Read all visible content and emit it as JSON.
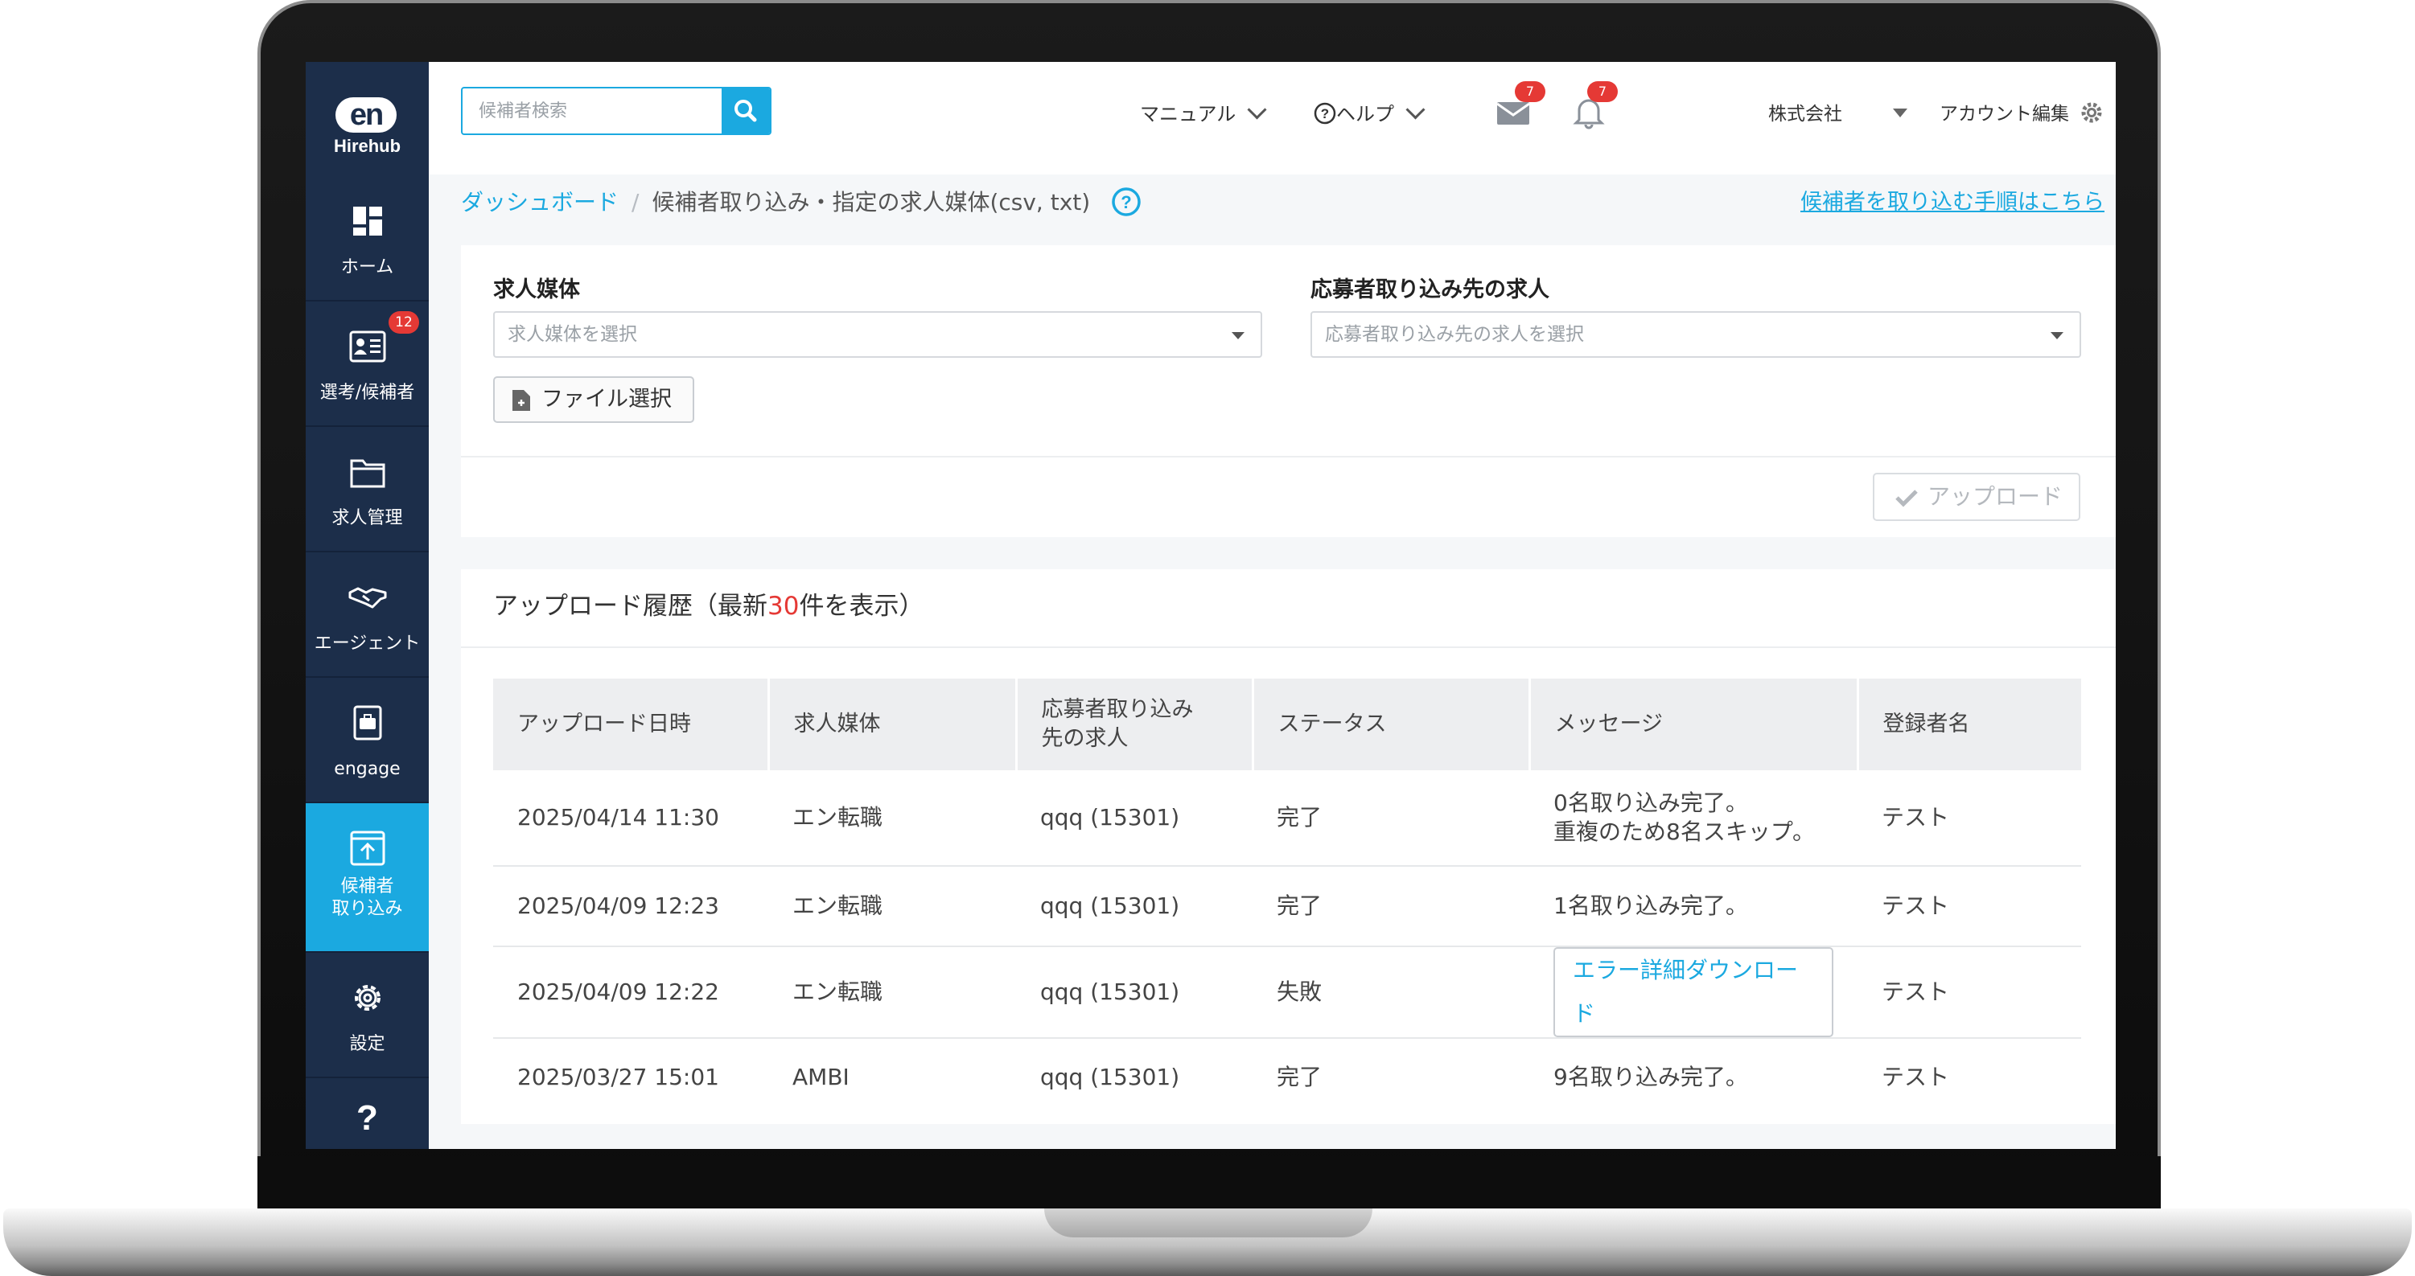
{
  "app": {
    "logo_mark": "en",
    "logo_brand": "Hirehub"
  },
  "sidebar": {
    "items": [
      {
        "label": "ホーム",
        "icon": "dashboard-icon"
      },
      {
        "label": "選考/候補者",
        "icon": "id-card-icon",
        "badge": "12"
      },
      {
        "label": "求人管理",
        "icon": "folder-icon"
      },
      {
        "label": "エージェント",
        "icon": "handshake-icon"
      },
      {
        "label": "engage",
        "icon": "briefcase-doc-icon"
      },
      {
        "label_line1": "候補者",
        "label_line2": "取り込み",
        "icon": "import-icon",
        "active": true
      },
      {
        "label": "設定",
        "icon": "gear-icon"
      }
    ]
  },
  "header": {
    "search_placeholder": "候補者検索",
    "manual": "マニュアル",
    "help": "ヘルプ",
    "mail_count": "7",
    "bell_count": "7",
    "company": "株式会社",
    "account": "アカウント編集"
  },
  "breadcrumb": {
    "home": "ダッシュボード",
    "current": "候補者取り込み・指定の求人媒体(csv, txt)",
    "help_link": "候補者を取り込む手順はこちら"
  },
  "upload_form": {
    "media_label": "求人媒体",
    "media_placeholder": "求人媒体を選択",
    "job_label": "応募者取り込み先の求人",
    "job_placeholder": "応募者取り込み先の求人を選択",
    "file_button": "ファイル選択",
    "upload_button": "アップロード"
  },
  "history": {
    "title_prefix": "アップロード履歴（最新",
    "title_count": "30",
    "title_suffix": "件を表示）",
    "columns": [
      "アップロード日時",
      "求人媒体",
      "応募者取り込み先の求人",
      "ステータス",
      "メッセージ",
      "登録者名"
    ],
    "rows": [
      {
        "datetime": "2025/04/14 11:30",
        "media": "エン転職",
        "job": "qqq (15301)",
        "status": "完了",
        "message_line1": "0名取り込み完了。",
        "message_line2": "重複のため8名スキップ。",
        "registrant": "テスト"
      },
      {
        "datetime": "2025/04/09 12:23",
        "media": "エン転職",
        "job": "qqq (15301)",
        "status": "完了",
        "message_line1": "1名取り込み完了。",
        "registrant": "テスト"
      },
      {
        "datetime": "2025/04/09 12:22",
        "media": "エン転職",
        "job": "qqq (15301)",
        "status": "失敗",
        "message_button": "エラー詳細ダウンロード",
        "registrant": "テスト"
      },
      {
        "datetime": "2025/03/27 15:01",
        "media": "AMBI",
        "job": "qqq (15301)",
        "status": "完了",
        "message_line1": "9名取り込み完了。",
        "registrant": "テスト"
      }
    ]
  },
  "colors": {
    "accent": "#1ba9e0",
    "sidebar": "#1c2e4a",
    "error": "#e53935"
  }
}
